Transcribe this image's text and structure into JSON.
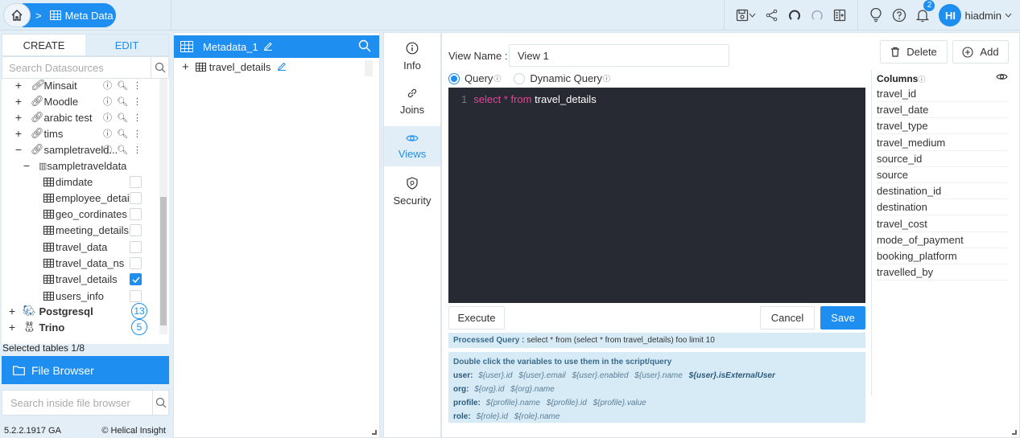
{
  "breadcrumb": {
    "home_icon": "home-icon",
    "separator": ">",
    "current": "Meta Data",
    "current_icon": "table-icon"
  },
  "toolbar": {
    "icons": [
      "save-icon",
      "chevron-down-icon",
      "share-icon",
      "undo-icon",
      "redo-icon",
      "panel-toggle-icon",
      "lightbulb-icon",
      "help-icon",
      "bell-icon"
    ],
    "notifications_count": "2",
    "avatar_initials": "HI",
    "username": "hiadmin",
    "username_chevron": "v"
  },
  "left_panel": {
    "tabs": [
      {
        "label": "CREATE",
        "active": false
      },
      {
        "label": "EDIT",
        "active": true
      }
    ],
    "search_placeholder": "Search Datasources",
    "datasources": [
      {
        "label": "Minsait",
        "expander": "+"
      },
      {
        "label": "Moodle",
        "expander": "+"
      },
      {
        "label": "arabic test",
        "expander": "+"
      },
      {
        "label": "tims",
        "expander": "+"
      },
      {
        "label": "sampletraveld...",
        "expander": "−"
      }
    ],
    "schema": {
      "label": "sampletraveldata",
      "expander": "−"
    },
    "tables": [
      {
        "label": "dimdate",
        "checked": false
      },
      {
        "label": "employee_details",
        "checked": false
      },
      {
        "label": "geo_cordinates",
        "checked": false
      },
      {
        "label": "meeting_details",
        "checked": false
      },
      {
        "label": "travel_data",
        "checked": false
      },
      {
        "label": "travel_data_ns",
        "checked": false
      },
      {
        "label": "travel_details",
        "checked": true
      },
      {
        "label": "users_info",
        "checked": false
      }
    ],
    "connectors": [
      {
        "label": "Postgresql",
        "count": "13",
        "expander": "+"
      },
      {
        "label": "Trino",
        "count": "5",
        "expander": "+"
      }
    ],
    "selected_tables": "Selected tables 1/8",
    "file_browser_label": "File Browser",
    "file_search_placeholder": "Search inside file browser",
    "version": "5.2.2.1917 GA",
    "copyright": "Helical Insight"
  },
  "metadata_panel": {
    "title": "Metadata_1",
    "items": [
      {
        "label": "travel_details",
        "expander": "+"
      }
    ]
  },
  "side_menu": [
    {
      "label": "Info",
      "icon": "info-icon",
      "active": false
    },
    {
      "label": "Joins",
      "icon": "link-icon",
      "active": false
    },
    {
      "label": "Views",
      "icon": "eye-icon",
      "active": true
    },
    {
      "label": "Security",
      "icon": "shield-icon",
      "active": false
    }
  ],
  "editor": {
    "view_name_label": "View Name :",
    "view_name_value": "View 1",
    "query_options": [
      {
        "label": "Query",
        "selected": true
      },
      {
        "label": "Dynamic Query",
        "selected": false
      }
    ],
    "info_sup": "ⓘ",
    "code": {
      "line_number": "1",
      "keyword1": "select * from",
      "rest": " travel_details"
    },
    "execute_label": "Execute",
    "cancel_label": "Cancel",
    "save_label": "Save",
    "delete_label": "Delete",
    "add_label": "Add",
    "processed_label": "Processed Query :",
    "processed_query": "select * from (select * from travel_details) foo limit 10",
    "variables_title": "Double click the variables to use them in the script/query",
    "variables": [
      {
        "key": "user:",
        "values": [
          "${user}.id",
          "${user}.email",
          "${user}.enabled",
          "${user}.name"
        ],
        "bold_value": "${user}.isExternalUser"
      },
      {
        "key": "org:",
        "values": [
          "${org}.id",
          "${org}.name"
        ]
      },
      {
        "key": "profile:",
        "values": [
          "${profile}.name",
          "${profile}.id",
          "${profile}.value"
        ]
      },
      {
        "key": "role:",
        "values": [
          "${role}.id",
          "${role}.name"
        ]
      }
    ]
  },
  "columns_panel": {
    "title": "Columns",
    "columns": [
      "travel_id",
      "travel_date",
      "travel_type",
      "travel_medium",
      "source_id",
      "source",
      "destination_id",
      "destination",
      "travel_cost",
      "mode_of_payment",
      "booking_platform",
      "travelled_by"
    ]
  },
  "colors": {
    "accent": "#1e8ef0",
    "editor_bg": "#272a33",
    "keyword": "#e64398",
    "panel_bg": "#e3eef7"
  }
}
